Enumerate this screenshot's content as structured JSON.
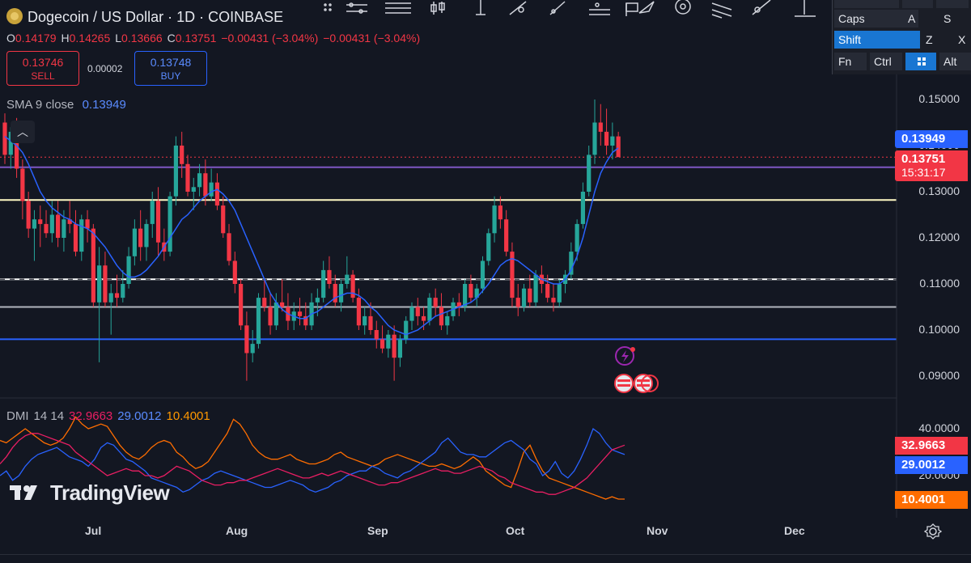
{
  "header": {
    "symbol_title": "Dogecoin / US Dollar · 1D · COINBASE",
    "ohlc": {
      "o_label": "O",
      "o_value": "0.14179",
      "h_label": "H",
      "h_value": "0.14265",
      "l_label": "L",
      "l_value": "0.13666",
      "c_label": "C",
      "c_value": "0.13751",
      "change_1": "−0.00431 (−3.04%)",
      "change_2": "−0.00431 (−3.04%)"
    },
    "sell": {
      "price": "0.13746",
      "label": "SELL"
    },
    "buy": {
      "price": "0.13748",
      "label": "BUY"
    },
    "spread": "0.00002"
  },
  "indicators": {
    "sma": {
      "label": "SMA",
      "params": "9 close",
      "value": "0.13949"
    },
    "dmi": {
      "label": "DMI",
      "params": "14 14",
      "adx_plus": "32.9663",
      "adx_minus": "29.0012",
      "adx": "10.4001"
    }
  },
  "price_tags": {
    "sma": "0.13949",
    "last": "0.13751",
    "countdown": "15:31:17",
    "dmi_plus": "32.9663",
    "dmi_minus": "29.0012",
    "dmi_adx": "10.4001"
  },
  "keyboard": {
    "caps": "Caps",
    "a": "A",
    "s": "S",
    "shift": "Shift",
    "z": "Z",
    "x": "X",
    "fn": "Fn",
    "ctrl": "Ctrl",
    "alt": "Alt"
  },
  "branding": "TradingView",
  "colors": {
    "bull": "#26a69a",
    "bear": "#f23645",
    "sma": "#2962ff",
    "dmi_plus": "#e91e63",
    "dmi_minus": "#2962ff",
    "adx": "#ff6d00",
    "level_purple": "#7e57c2",
    "level_yellow": "#fff9c4",
    "level_white": "#ffffff",
    "level_gray": "#b2b5be",
    "level_blue": "#2962ff"
  },
  "chart_data": {
    "type": "candlestick",
    "price_axis": [
      "0.15000",
      "0.14000",
      "0.13000",
      "0.12000",
      "0.11000",
      "0.10000",
      "0.09000"
    ],
    "date_axis": [
      "Jul",
      "Aug",
      "Sep",
      "Oct",
      "Nov",
      "Dec"
    ],
    "dmi_axis": [
      "40.0000",
      "20.0000"
    ],
    "ylim": [
      0.087,
      0.152
    ],
    "horizontal_levels": [
      0.1353,
      0.1282,
      0.111,
      0.105,
      0.098
    ],
    "candles_ohlc": [
      [
        0.145,
        0.147,
        0.136,
        0.138
      ],
      [
        0.138,
        0.144,
        0.135,
        0.143
      ],
      [
        0.143,
        0.146,
        0.133,
        0.135
      ],
      [
        0.135,
        0.137,
        0.124,
        0.128
      ],
      [
        0.128,
        0.13,
        0.12,
        0.122
      ],
      [
        0.122,
        0.126,
        0.115,
        0.124
      ],
      [
        0.124,
        0.127,
        0.118,
        0.123
      ],
      [
        0.123,
        0.126,
        0.12,
        0.121
      ],
      [
        0.121,
        0.128,
        0.119,
        0.125
      ],
      [
        0.125,
        0.128,
        0.118,
        0.12
      ],
      [
        0.12,
        0.126,
        0.117,
        0.124
      ],
      [
        0.124,
        0.128,
        0.121,
        0.123
      ],
      [
        0.123,
        0.126,
        0.116,
        0.117
      ],
      [
        0.117,
        0.125,
        0.115,
        0.124
      ],
      [
        0.124,
        0.126,
        0.119,
        0.122
      ],
      [
        0.122,
        0.123,
        0.105,
        0.106
      ],
      [
        0.106,
        0.118,
        0.093,
        0.114
      ],
      [
        0.114,
        0.117,
        0.105,
        0.106
      ],
      [
        0.106,
        0.11,
        0.099,
        0.108
      ],
      [
        0.108,
        0.112,
        0.105,
        0.107
      ],
      [
        0.107,
        0.113,
        0.106,
        0.11
      ],
      [
        0.11,
        0.118,
        0.109,
        0.116
      ],
      [
        0.116,
        0.124,
        0.114,
        0.122
      ],
      [
        0.122,
        0.126,
        0.115,
        0.118
      ],
      [
        0.118,
        0.124,
        0.115,
        0.123
      ],
      [
        0.123,
        0.13,
        0.12,
        0.128
      ],
      [
        0.128,
        0.131,
        0.116,
        0.119
      ],
      [
        0.119,
        0.122,
        0.115,
        0.117
      ],
      [
        0.117,
        0.13,
        0.116,
        0.129
      ],
      [
        0.129,
        0.142,
        0.127,
        0.14
      ],
      [
        0.14,
        0.143,
        0.133,
        0.136
      ],
      [
        0.136,
        0.138,
        0.129,
        0.13
      ],
      [
        0.13,
        0.133,
        0.126,
        0.131
      ],
      [
        0.131,
        0.136,
        0.129,
        0.134
      ],
      [
        0.134,
        0.137,
        0.127,
        0.129
      ],
      [
        0.129,
        0.135,
        0.128,
        0.132
      ],
      [
        0.132,
        0.134,
        0.126,
        0.127
      ],
      [
        0.127,
        0.129,
        0.12,
        0.121
      ],
      [
        0.121,
        0.123,
        0.114,
        0.115
      ],
      [
        0.115,
        0.117,
        0.108,
        0.11
      ],
      [
        0.11,
        0.111,
        0.1,
        0.101
      ],
      [
        0.101,
        0.104,
        0.089,
        0.095
      ],
      [
        0.095,
        0.1,
        0.093,
        0.097
      ],
      [
        0.097,
        0.108,
        0.096,
        0.107
      ],
      [
        0.107,
        0.111,
        0.104,
        0.105
      ],
      [
        0.105,
        0.108,
        0.099,
        0.101
      ],
      [
        0.101,
        0.108,
        0.1,
        0.106
      ],
      [
        0.106,
        0.111,
        0.104,
        0.105
      ],
      [
        0.105,
        0.108,
        0.1,
        0.102
      ],
      [
        0.102,
        0.106,
        0.1,
        0.104
      ],
      [
        0.104,
        0.107,
        0.101,
        0.103
      ],
      [
        0.103,
        0.106,
        0.1,
        0.101
      ],
      [
        0.101,
        0.108,
        0.1,
        0.106
      ],
      [
        0.106,
        0.109,
        0.103,
        0.107
      ],
      [
        0.107,
        0.115,
        0.106,
        0.113
      ],
      [
        0.113,
        0.116,
        0.109,
        0.11
      ],
      [
        0.11,
        0.112,
        0.105,
        0.106
      ],
      [
        0.106,
        0.111,
        0.104,
        0.11
      ],
      [
        0.11,
        0.116,
        0.109,
        0.112
      ],
      [
        0.112,
        0.113,
        0.106,
        0.107
      ],
      [
        0.107,
        0.109,
        0.1,
        0.101
      ],
      [
        0.101,
        0.105,
        0.099,
        0.103
      ],
      [
        0.103,
        0.106,
        0.099,
        0.1
      ],
      [
        0.1,
        0.102,
        0.096,
        0.098
      ],
      [
        0.098,
        0.101,
        0.095,
        0.096
      ],
      [
        0.096,
        0.1,
        0.094,
        0.099
      ],
      [
        0.099,
        0.101,
        0.089,
        0.094
      ],
      [
        0.094,
        0.099,
        0.092,
        0.098
      ],
      [
        0.098,
        0.103,
        0.097,
        0.102
      ],
      [
        0.102,
        0.106,
        0.1,
        0.105
      ],
      [
        0.105,
        0.107,
        0.101,
        0.103
      ],
      [
        0.103,
        0.105,
        0.1,
        0.102
      ],
      [
        0.102,
        0.108,
        0.101,
        0.107
      ],
      [
        0.107,
        0.109,
        0.103,
        0.105
      ],
      [
        0.105,
        0.108,
        0.1,
        0.101
      ],
      [
        0.101,
        0.104,
        0.099,
        0.103
      ],
      [
        0.103,
        0.107,
        0.102,
        0.106
      ],
      [
        0.106,
        0.108,
        0.103,
        0.105
      ],
      [
        0.105,
        0.111,
        0.104,
        0.11
      ],
      [
        0.11,
        0.112,
        0.106,
        0.107
      ],
      [
        0.107,
        0.11,
        0.105,
        0.109
      ],
      [
        0.109,
        0.116,
        0.108,
        0.115
      ],
      [
        0.115,
        0.122,
        0.114,
        0.121
      ],
      [
        0.121,
        0.129,
        0.119,
        0.127
      ],
      [
        0.127,
        0.129,
        0.122,
        0.124
      ],
      [
        0.124,
        0.126,
        0.116,
        0.117
      ],
      [
        0.117,
        0.119,
        0.105,
        0.107
      ],
      [
        0.107,
        0.11,
        0.103,
        0.105
      ],
      [
        0.105,
        0.11,
        0.104,
        0.109
      ],
      [
        0.109,
        0.112,
        0.105,
        0.106
      ],
      [
        0.106,
        0.113,
        0.105,
        0.112
      ],
      [
        0.112,
        0.114,
        0.108,
        0.11
      ],
      [
        0.11,
        0.112,
        0.106,
        0.107
      ],
      [
        0.107,
        0.11,
        0.104,
        0.106
      ],
      [
        0.106,
        0.111,
        0.105,
        0.11
      ],
      [
        0.11,
        0.113,
        0.108,
        0.112
      ],
      [
        0.112,
        0.119,
        0.111,
        0.117
      ],
      [
        0.117,
        0.124,
        0.115,
        0.123
      ],
      [
        0.123,
        0.132,
        0.122,
        0.13
      ],
      [
        0.13,
        0.14,
        0.129,
        0.138
      ],
      [
        0.138,
        0.15,
        0.136,
        0.145
      ],
      [
        0.145,
        0.149,
        0.14,
        0.143
      ],
      [
        0.143,
        0.148,
        0.138,
        0.14
      ],
      [
        0.14,
        0.145,
        0.137,
        0.142
      ],
      [
        0.142,
        0.143,
        0.138,
        0.1375
      ]
    ],
    "sma_9": [
      0.142,
      0.141,
      0.14,
      0.1385,
      0.136,
      0.133,
      0.13,
      0.128,
      0.1265,
      0.1255,
      0.1245,
      0.124,
      0.123,
      0.1225,
      0.122,
      0.121,
      0.1195,
      0.118,
      0.116,
      0.114,
      0.1125,
      0.1115,
      0.1115,
      0.112,
      0.113,
      0.1145,
      0.116,
      0.118,
      0.12,
      0.122,
      0.124,
      0.125,
      0.1265,
      0.128,
      0.129,
      0.13,
      0.1305,
      0.1295,
      0.128,
      0.126,
      0.123,
      0.12,
      0.117,
      0.114,
      0.111,
      0.108,
      0.106,
      0.1045,
      0.1035,
      0.103,
      0.1025,
      0.1025,
      0.1035,
      0.104,
      0.105,
      0.106,
      0.107,
      0.1075,
      0.108,
      0.108,
      0.1075,
      0.1065,
      0.105,
      0.104,
      0.1025,
      0.101,
      0.1,
      0.0995,
      0.099,
      0.0995,
      0.1,
      0.101,
      0.102,
      0.103,
      0.1035,
      0.104,
      0.1045,
      0.105,
      0.1055,
      0.106,
      0.107,
      0.1085,
      0.11,
      0.112,
      0.114,
      0.115,
      0.1155,
      0.115,
      0.114,
      0.113,
      0.112,
      0.111,
      0.1105,
      0.11,
      0.11,
      0.111,
      0.113,
      0.116,
      0.12,
      0.125,
      0.13,
      0.134,
      0.1365,
      0.1385,
      0.1395
    ],
    "dmi_plus_series": [
      25,
      28,
      32,
      35,
      37,
      38,
      38,
      37,
      36,
      35,
      34,
      33,
      30,
      28,
      26,
      24,
      22,
      20,
      21,
      22,
      23,
      22,
      22,
      20,
      20,
      19,
      20,
      22,
      24,
      23,
      22,
      20,
      18,
      17,
      16,
      16,
      17,
      17,
      18,
      18,
      19,
      20,
      21,
      22,
      23,
      22,
      21,
      20,
      19,
      19,
      20,
      21,
      20,
      21,
      22,
      21,
      20,
      19,
      18,
      17,
      16,
      16,
      17,
      17,
      18,
      19,
      20,
      21,
      22,
      23,
      22,
      22,
      21,
      21,
      22,
      23,
      24,
      23,
      22,
      20,
      19,
      17,
      16,
      15,
      14,
      13,
      13,
      12,
      12,
      13,
      14,
      15,
      17,
      19,
      22,
      25,
      28,
      31,
      32,
      33
    ],
    "dmi_minus_series": [
      20,
      22,
      18,
      20,
      24,
      27,
      29,
      30,
      31,
      32,
      30,
      28,
      27,
      26,
      24,
      27,
      32,
      34,
      33,
      30,
      27,
      26,
      24,
      22,
      19,
      18,
      17,
      16,
      15,
      13,
      14,
      16,
      18,
      19,
      21,
      22,
      21,
      20,
      19,
      18,
      17,
      16,
      15,
      15,
      16,
      17,
      18,
      17,
      16,
      14,
      13,
      14,
      15,
      17,
      18,
      20,
      21,
      22,
      22,
      24,
      23,
      21,
      20,
      19,
      21,
      22,
      24,
      26,
      28,
      30,
      34,
      36,
      33,
      30,
      29,
      29,
      28,
      28,
      30,
      32,
      34,
      35,
      33,
      31,
      27,
      25,
      20,
      22,
      26,
      21,
      19,
      22,
      27,
      33,
      40,
      38,
      34,
      31,
      30,
      29
    ],
    "adx_series": [
      35,
      34,
      36,
      38,
      40,
      38,
      36,
      34,
      33,
      34,
      36,
      40,
      45,
      42,
      40,
      41,
      42,
      41,
      37,
      33,
      30,
      28,
      27,
      29,
      32,
      34,
      35,
      34,
      30,
      28,
      25,
      23,
      24,
      26,
      30,
      34,
      38,
      44,
      42,
      38,
      33,
      30,
      28,
      27,
      27,
      28,
      29,
      27,
      26,
      25,
      25,
      26,
      27,
      29,
      30,
      28,
      27,
      26,
      25,
      24,
      25,
      27,
      28,
      29,
      28,
      27,
      26,
      25,
      24,
      24,
      25,
      24,
      23,
      24,
      26,
      28,
      26,
      22,
      20,
      18,
      16,
      15,
      22,
      30,
      33,
      27,
      22,
      19,
      18,
      17,
      16,
      15,
      14,
      13,
      12,
      11,
      10,
      11,
      10,
      10
    ]
  }
}
